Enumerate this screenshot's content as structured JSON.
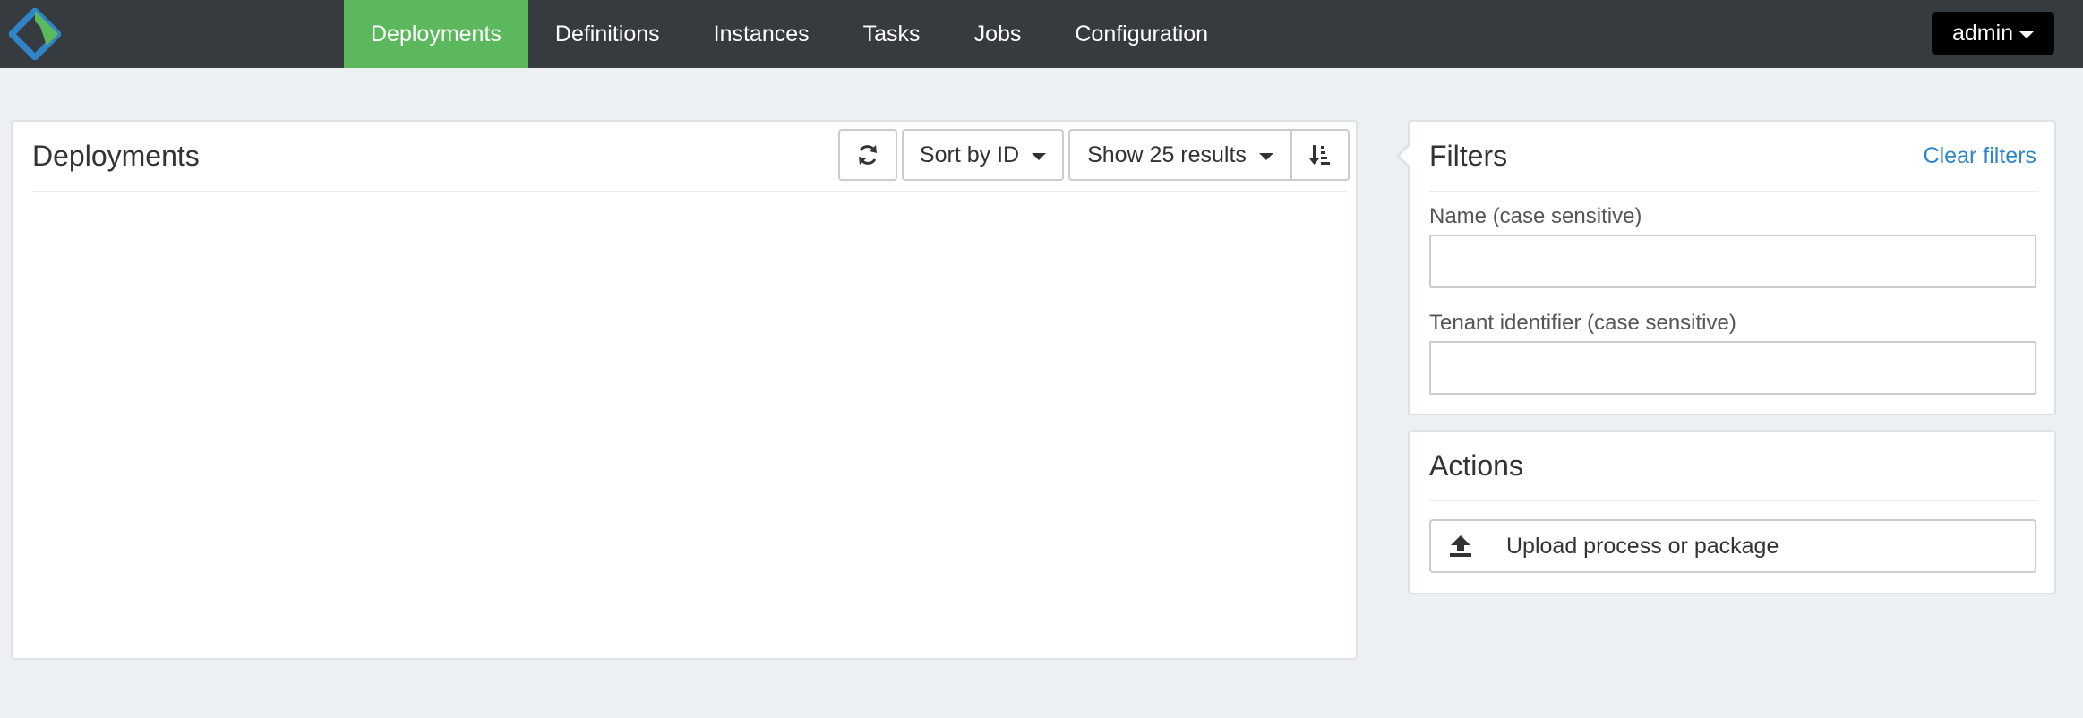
{
  "navbar": {
    "tabs": [
      {
        "label": "Deployments",
        "active": true
      },
      {
        "label": "Definitions",
        "active": false
      },
      {
        "label": "Instances",
        "active": false
      },
      {
        "label": "Tasks",
        "active": false
      },
      {
        "label": "Jobs",
        "active": false
      },
      {
        "label": "Configuration",
        "active": false
      }
    ],
    "user_label": "admin"
  },
  "deployments_panel": {
    "title": "Deployments",
    "refresh_icon": "refresh-icon",
    "sort_label": "Sort by ID",
    "show_label": "Show 25 results",
    "order_icon": "sort-descending-icon"
  },
  "filters_panel": {
    "title": "Filters",
    "clear_label": "Clear filters",
    "name_label": "Name (case sensitive)",
    "name_value": "",
    "tenant_label": "Tenant identifier (case sensitive)",
    "tenant_value": ""
  },
  "actions_panel": {
    "title": "Actions",
    "upload_label": "Upload process or package",
    "upload_icon": "upload-icon"
  },
  "colors": {
    "navbar_bg": "#353b3f",
    "active_tab": "#5cb85c",
    "link": "#2f85c7",
    "page_bg": "#edf0f2"
  }
}
